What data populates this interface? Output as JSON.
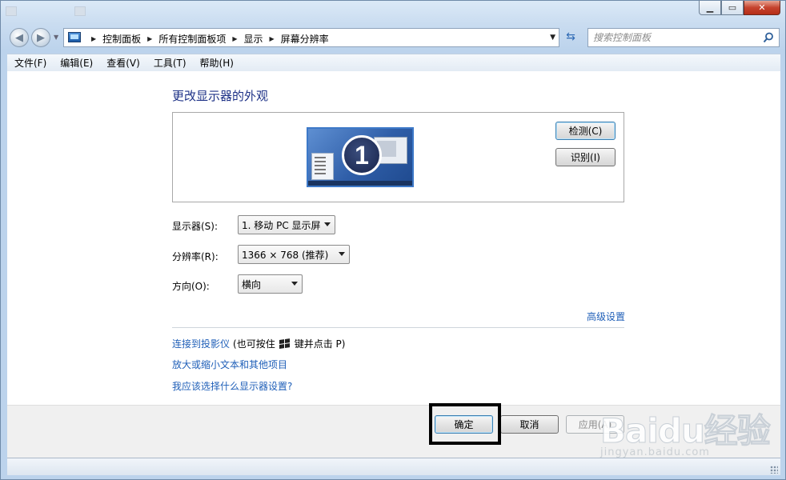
{
  "window": {
    "caption_buttons": {
      "min": "▁",
      "max": "▭",
      "close": "✕"
    }
  },
  "nav": {
    "crumbs": [
      "控制面板",
      "所有控制面板项",
      "显示",
      "屏幕分辨率"
    ],
    "search_placeholder": "搜索控制面板"
  },
  "menu": [
    "文件(F)",
    "编辑(E)",
    "查看(V)",
    "工具(T)",
    "帮助(H)"
  ],
  "main": {
    "heading": "更改显示器的外观",
    "monitor_number": "1",
    "detect_label": "检测(C)",
    "identify_label": "识别(I)",
    "display_label": "显示器(S):",
    "display_value": "1. 移动 PC 显示屏",
    "resolution_label": "分辨率(R):",
    "resolution_value": "1366 × 768 (推荐)",
    "orientation_label": "方向(O):",
    "orientation_value": "横向",
    "advanced_link": "高级设置",
    "projector_link": "连接到投影仪",
    "projector_hint_pre": "(也可按住",
    "projector_hint_post": "键并点击 P)",
    "text_size_link": "放大或缩小文本和其他项目",
    "which_settings_link": "我应该选择什么显示器设置?"
  },
  "footer": {
    "ok": "确定",
    "cancel": "取消",
    "apply": "应用(A)"
  },
  "watermark": {
    "logo": "Baidu经验",
    "url": "jingyan.baidu.com"
  },
  "colors": {
    "link": "#1f5fb8",
    "heading": "#1e3287",
    "highlight_box": "#000000"
  }
}
